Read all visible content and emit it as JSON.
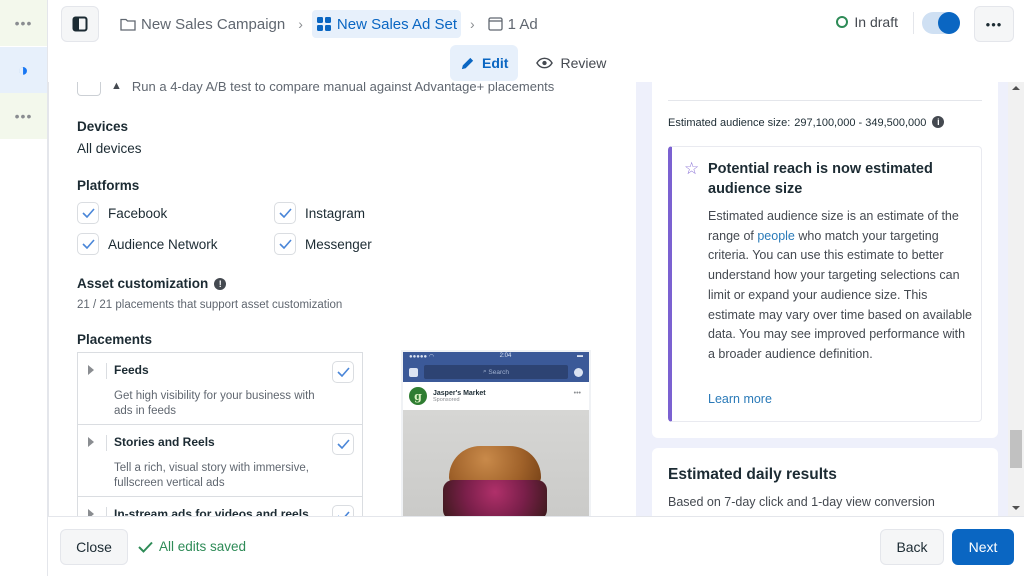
{
  "rail": {
    "items": [
      {
        "icon": "more-horizontal-icon",
        "glyph": "•••"
      },
      {
        "icon": "contrast-icon",
        "glyph": "◑"
      },
      {
        "icon": "more-horizontal-icon",
        "glyph": "•••"
      }
    ]
  },
  "header": {
    "breadcrumb": [
      {
        "label": "New Sales Campaign",
        "icon": "folder-icon"
      },
      {
        "label": "New Sales Ad Set",
        "icon": "grid-icon",
        "active": true
      },
      {
        "label": "1 Ad",
        "icon": "ad-frame-icon"
      }
    ],
    "status": "In draft",
    "toggle_on": true,
    "more_glyph": "•••"
  },
  "mode_tabs": [
    {
      "label": "Edit",
      "active": true
    },
    {
      "label": "Review",
      "active": false
    }
  ],
  "main": {
    "ab_test_text": "Run a 4-day A/B test to compare manual against Advantage+ placements",
    "devices": {
      "title": "Devices",
      "value": "All devices"
    },
    "platforms": {
      "title": "Platforms",
      "items": [
        {
          "label": "Facebook",
          "checked": true
        },
        {
          "label": "Instagram",
          "checked": true
        },
        {
          "label": "Audience Network",
          "checked": true
        },
        {
          "label": "Messenger",
          "checked": true
        }
      ]
    },
    "asset_customization": {
      "title": "Asset customization",
      "subtext": "21 / 21 placements that support asset customization"
    },
    "placements": {
      "title": "Placements",
      "items": [
        {
          "title": "Feeds",
          "desc": "Get high visibility for your business with ads in feeds",
          "checked": true
        },
        {
          "title": "Stories and Reels",
          "desc": "Tell a rich, visual story with immersive, fullscreen vertical ads",
          "checked": true
        },
        {
          "title": "In-stream ads for videos and reels",
          "desc": "",
          "checked": true
        }
      ]
    },
    "preview": {
      "time": "2:04",
      "search": "Search",
      "page_name": "Jasper's Market",
      "sponsored": "Sponsored",
      "logo_letter": "g"
    }
  },
  "right": {
    "audience_label": "Estimated audience size:",
    "audience_value": "297,100,000 - 349,500,000",
    "notice": {
      "title": "Potential reach is now estimated audience size",
      "body_pre": "Estimated audience size is an estimate of the range of ",
      "body_link": "people",
      "body_post": " who match your targeting criteria. You can use this estimate to better understand how your targeting selections can limit or expand your audience size. This estimate may vary over time based on available data. You may see improved performance with a broader audience definition.",
      "learn_more": "Learn more"
    },
    "daily_results": {
      "title": "Estimated daily results",
      "subtitle": "Based on 7-day click and 1-day view conversion"
    }
  },
  "footer": {
    "close": "Close",
    "saved_status": "All edits saved",
    "back": "Back",
    "next": "Next"
  },
  "colors": {
    "accent": "#0a66c2",
    "success": "#2e8b57",
    "notice_bar": "#7b61d1",
    "link": "#2a7ab8"
  }
}
